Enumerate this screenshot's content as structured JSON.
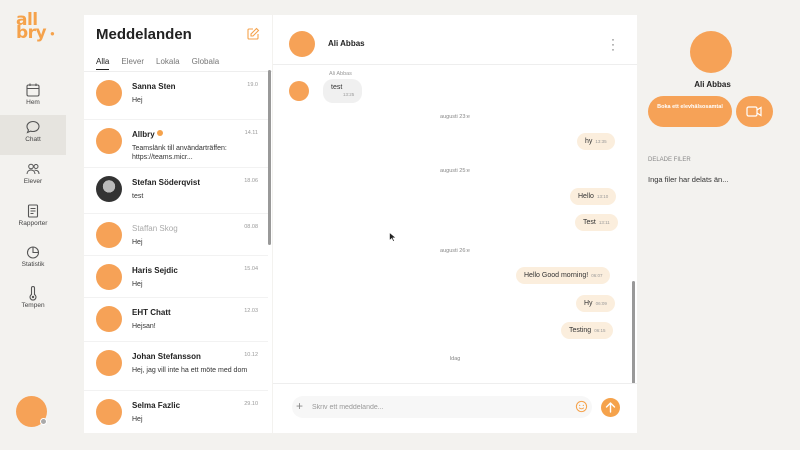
{
  "app": {
    "logo": "allbry",
    "accent": "#f6a257"
  },
  "nav": {
    "items": [
      {
        "label": "Hem",
        "icon": "calendar-icon"
      },
      {
        "label": "Chatt",
        "icon": "chat-icon",
        "active": true
      },
      {
        "label": "Elever",
        "icon": "people-icon"
      },
      {
        "label": "Rapporter",
        "icon": "report-icon"
      },
      {
        "label": "Statistik",
        "icon": "pie-chart-icon"
      },
      {
        "label": "Tempen",
        "icon": "thermometer-icon"
      }
    ]
  },
  "list": {
    "title": "Meddelanden",
    "tabs": [
      "Alla",
      "Elever",
      "Lokala",
      "Globala"
    ],
    "conversations": [
      {
        "name": "Sanna Sten",
        "time": "19.0",
        "message": "Hej"
      },
      {
        "name": "Allbry",
        "time": "14.11",
        "message": "Teamslänk till användarträffen: https://teams.micr..."
      },
      {
        "name": "Stefan Söderqvist",
        "time": "18.06",
        "message": "test"
      },
      {
        "name": "Staffan Skog",
        "time": "08.08",
        "message": "Hej"
      },
      {
        "name": "Haris Sejdic",
        "time": "15.04",
        "message": "Hej"
      },
      {
        "name": "EHT Chatt",
        "time": "12.03",
        "message": "Hejsan!"
      },
      {
        "name": "Johan Stefansson",
        "time": "10.12",
        "message": "Hej, jag vill inte ha ett möte med dom"
      },
      {
        "name": "Selma Fazlic",
        "time": "29.10",
        "message": "Hej"
      }
    ]
  },
  "chat": {
    "contact_name": "Ali Abbas",
    "incoming_sender": "Ali Abbas",
    "messages": [
      {
        "dir": "in",
        "text": "test",
        "time": "13:25"
      },
      {
        "day": "augusti 23:e"
      },
      {
        "dir": "out",
        "text": "hy",
        "time": "13:35"
      },
      {
        "day": "augusti 25:e"
      },
      {
        "dir": "out",
        "text": "Hello",
        "time": "13:10"
      },
      {
        "dir": "out",
        "text": "Test",
        "time": "13:11"
      },
      {
        "day": "augusti 26:e"
      },
      {
        "dir": "out",
        "text": "Hello Good morning!",
        "time": "06:07"
      },
      {
        "dir": "out",
        "text": "Hy",
        "time": "06:09"
      },
      {
        "dir": "out",
        "text": "Testing",
        "time": "06:15"
      },
      {
        "day": "Idag"
      }
    ],
    "composer_placeholder": "Skriv ett meddelande..."
  },
  "profile": {
    "name": "Ali Abbas",
    "book_label": "Boka ett elevhälsosamtal",
    "shared_files_heading": "DELADE FILER",
    "shared_files_empty": "Inga filer har delats än..."
  }
}
